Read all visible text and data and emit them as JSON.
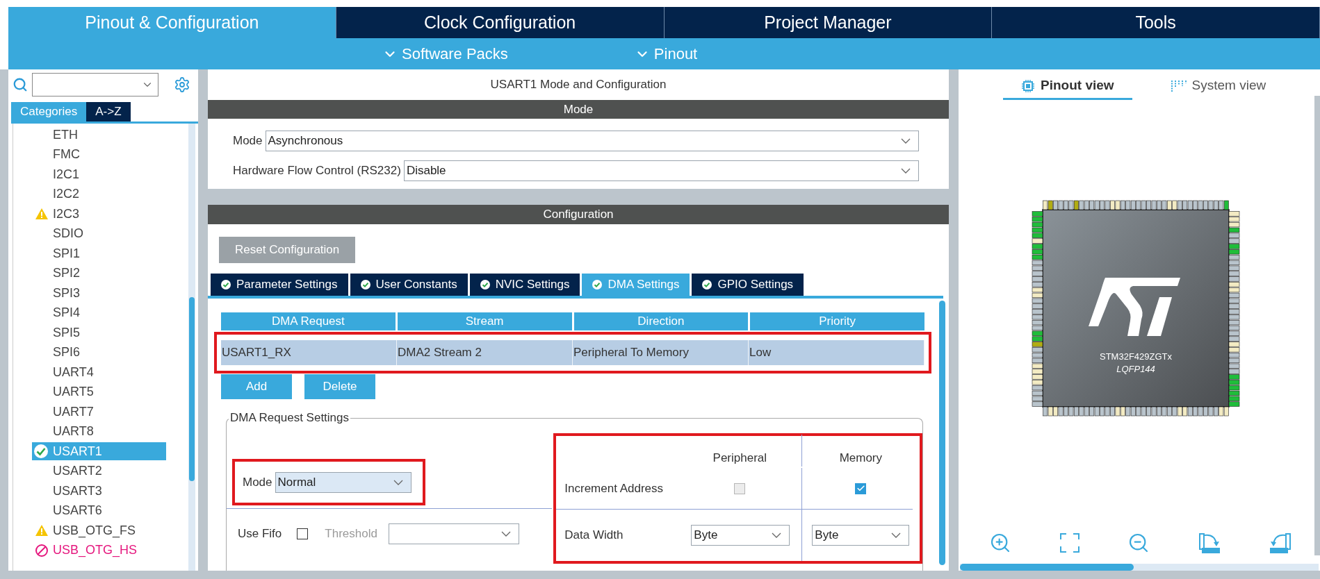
{
  "top_tabs": [
    {
      "label": "Pinout & Configuration",
      "selected": true
    },
    {
      "label": "Clock Configuration",
      "selected": false
    },
    {
      "label": "Project Manager",
      "selected": false
    },
    {
      "label": "Tools",
      "selected": false
    }
  ],
  "sub_menu": [
    "Software Packs",
    "Pinout"
  ],
  "sidebar": {
    "tabs": [
      {
        "label": "Categories",
        "selected": true
      },
      {
        "label": "A->Z",
        "selected": false
      }
    ],
    "items": [
      {
        "label": "ETH",
        "kind": "plain",
        "selected": false
      },
      {
        "label": "FMC",
        "kind": "plain",
        "selected": false
      },
      {
        "label": "I2C1",
        "kind": "plain",
        "selected": false
      },
      {
        "label": "I2C2",
        "kind": "plain",
        "selected": false
      },
      {
        "label": "I2C3",
        "kind": "warning",
        "selected": false
      },
      {
        "label": "SDIO",
        "kind": "plain",
        "selected": false
      },
      {
        "label": "SPI1",
        "kind": "plain",
        "selected": false
      },
      {
        "label": "SPI2",
        "kind": "plain",
        "selected": false
      },
      {
        "label": "SPI3",
        "kind": "plain",
        "selected": false
      },
      {
        "label": "SPI4",
        "kind": "plain",
        "selected": false
      },
      {
        "label": "SPI5",
        "kind": "plain",
        "selected": false
      },
      {
        "label": "SPI6",
        "kind": "plain",
        "selected": false
      },
      {
        "label": "UART4",
        "kind": "plain",
        "selected": false
      },
      {
        "label": "UART5",
        "kind": "plain",
        "selected": false
      },
      {
        "label": "UART7",
        "kind": "plain",
        "selected": false
      },
      {
        "label": "UART8",
        "kind": "plain",
        "selected": false
      },
      {
        "label": "USART1",
        "kind": "ok",
        "selected": true
      },
      {
        "label": "USART2",
        "kind": "plain",
        "selected": false
      },
      {
        "label": "USART3",
        "kind": "plain",
        "selected": false
      },
      {
        "label": "USART6",
        "kind": "plain",
        "selected": false
      },
      {
        "label": "USB_OTG_FS",
        "kind": "warning",
        "selected": false
      },
      {
        "label": "USB_OTG_HS",
        "kind": "error",
        "selected": false
      }
    ]
  },
  "config": {
    "title": "USART1 Mode and Configuration",
    "mode_section": {
      "title": "Mode",
      "fields": [
        {
          "label": "Mode",
          "value": "Asynchronous"
        },
        {
          "label": "Hardware Flow Control (RS232)",
          "value": "Disable"
        }
      ]
    },
    "config_section": {
      "title": "Configuration",
      "reset_button": "Reset Configuration",
      "tabs": [
        {
          "label": "Parameter Settings",
          "selected": false
        },
        {
          "label": "User Constants",
          "selected": false
        },
        {
          "label": "NVIC Settings",
          "selected": false
        },
        {
          "label": "DMA Settings",
          "selected": true
        },
        {
          "label": "GPIO Settings",
          "selected": false
        }
      ]
    },
    "dma_table": {
      "columns": [
        "DMA Request",
        "Stream",
        "Direction",
        "Priority"
      ],
      "rows": [
        {
          "cells": [
            "USART1_RX",
            "DMA2 Stream 2",
            "Peripheral To Memory",
            "Low"
          ],
          "selected": true
        }
      ]
    },
    "buttons": [
      "Add",
      "Delete"
    ],
    "request_settings": {
      "title": "DMA Request Settings",
      "mode": {
        "label": "Mode",
        "value": "Normal"
      },
      "use_fifo": {
        "label": "Use Fifo",
        "checked": false
      },
      "threshold": {
        "label": "Threshold",
        "disabled": true
      },
      "columns": [
        "Peripheral",
        "Memory"
      ],
      "increment_address": {
        "label": "Increment Address",
        "peripheral": {
          "checked": false,
          "disabled": true
        },
        "memory": {
          "checked": true
        }
      },
      "data_width": {
        "label": "Data Width",
        "peripheral": "Byte",
        "memory": "Byte"
      }
    }
  },
  "pinout": {
    "tabs": [
      {
        "label": "Pinout view",
        "selected": true
      },
      {
        "label": "System view",
        "selected": false
      }
    ],
    "chip": {
      "part": "STM32F429ZGTx",
      "package": "LQFP144"
    }
  }
}
